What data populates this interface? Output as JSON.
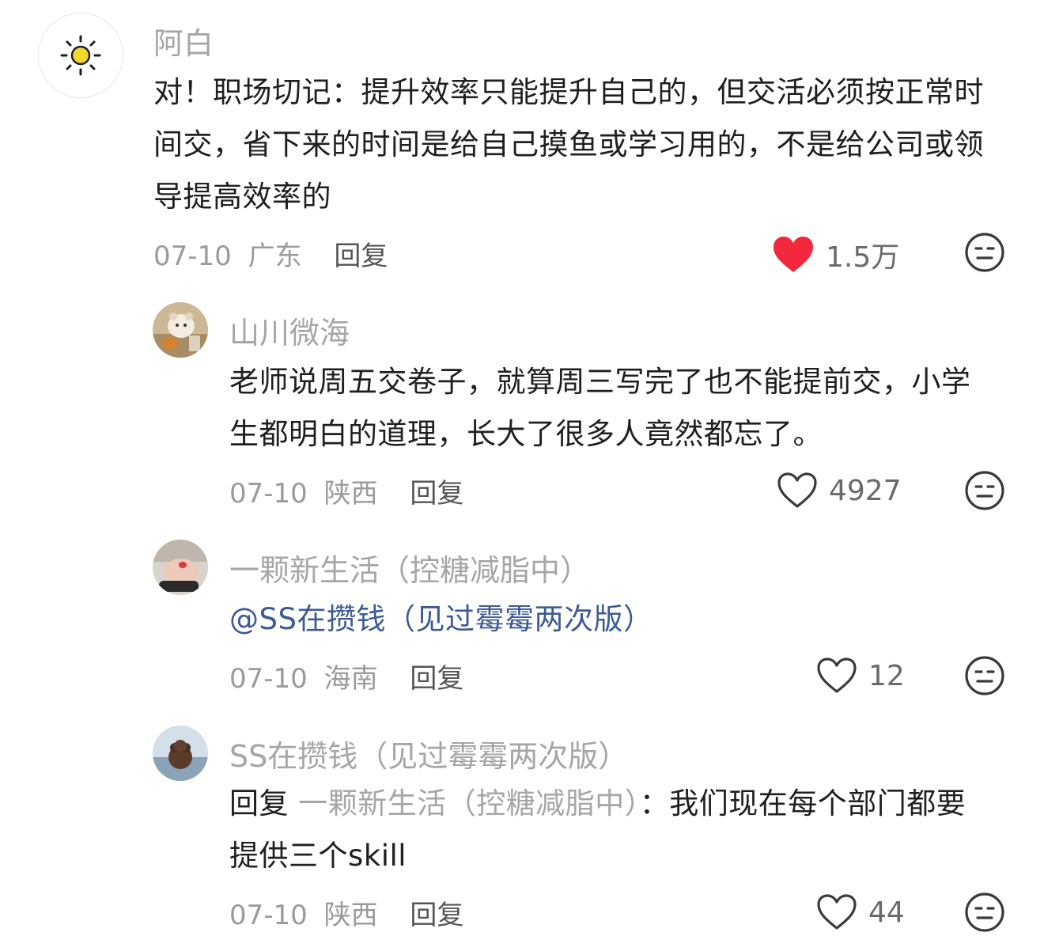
{
  "comments": [
    {
      "username": "阿白",
      "text": "对！职场切记：提升效率只能提升自己的，但交活必须按正常时间交，省下来的时间是给自己摸鱼或学习用的，不是给公司或领导提高效率的",
      "date": "07-10",
      "location": "广东",
      "reply_label": "回复",
      "likes": "1.5万",
      "liked": true,
      "avatar_icon": "sun-icon"
    },
    {
      "username": "山川微海",
      "text": "老师说周五交卷子，就算周三写完了也不能提前交，小学生都明白的道理，长大了很多人竟然都忘了。",
      "date": "07-10",
      "location": "陕西",
      "reply_label": "回复",
      "likes": "4927",
      "liked": false,
      "avatar_icon": "hamster-photo"
    },
    {
      "username": "一颗新生活（控糖减脂中）",
      "text": "@SS在攒钱（见过霉霉两次版）",
      "date": "07-10",
      "location": "海南",
      "reply_label": "回复",
      "likes": "12",
      "liked": false,
      "avatar_icon": "hand-photo"
    },
    {
      "username": "SS在攒钱（见过霉霉两次版）",
      "reply_prefix": "回复",
      "reply_to": "一颗新生活（控糖减脂中）",
      "text": "：我们现在每个部门都要提供三个skill",
      "date": "07-10",
      "location": "陕西",
      "reply_label": "回复",
      "likes": "44",
      "liked": false,
      "avatar_icon": "dog-photo"
    }
  ],
  "colors": {
    "liked_heart": "#f2283c",
    "mention": "#3c5b94",
    "username": "#a6a6a6"
  }
}
